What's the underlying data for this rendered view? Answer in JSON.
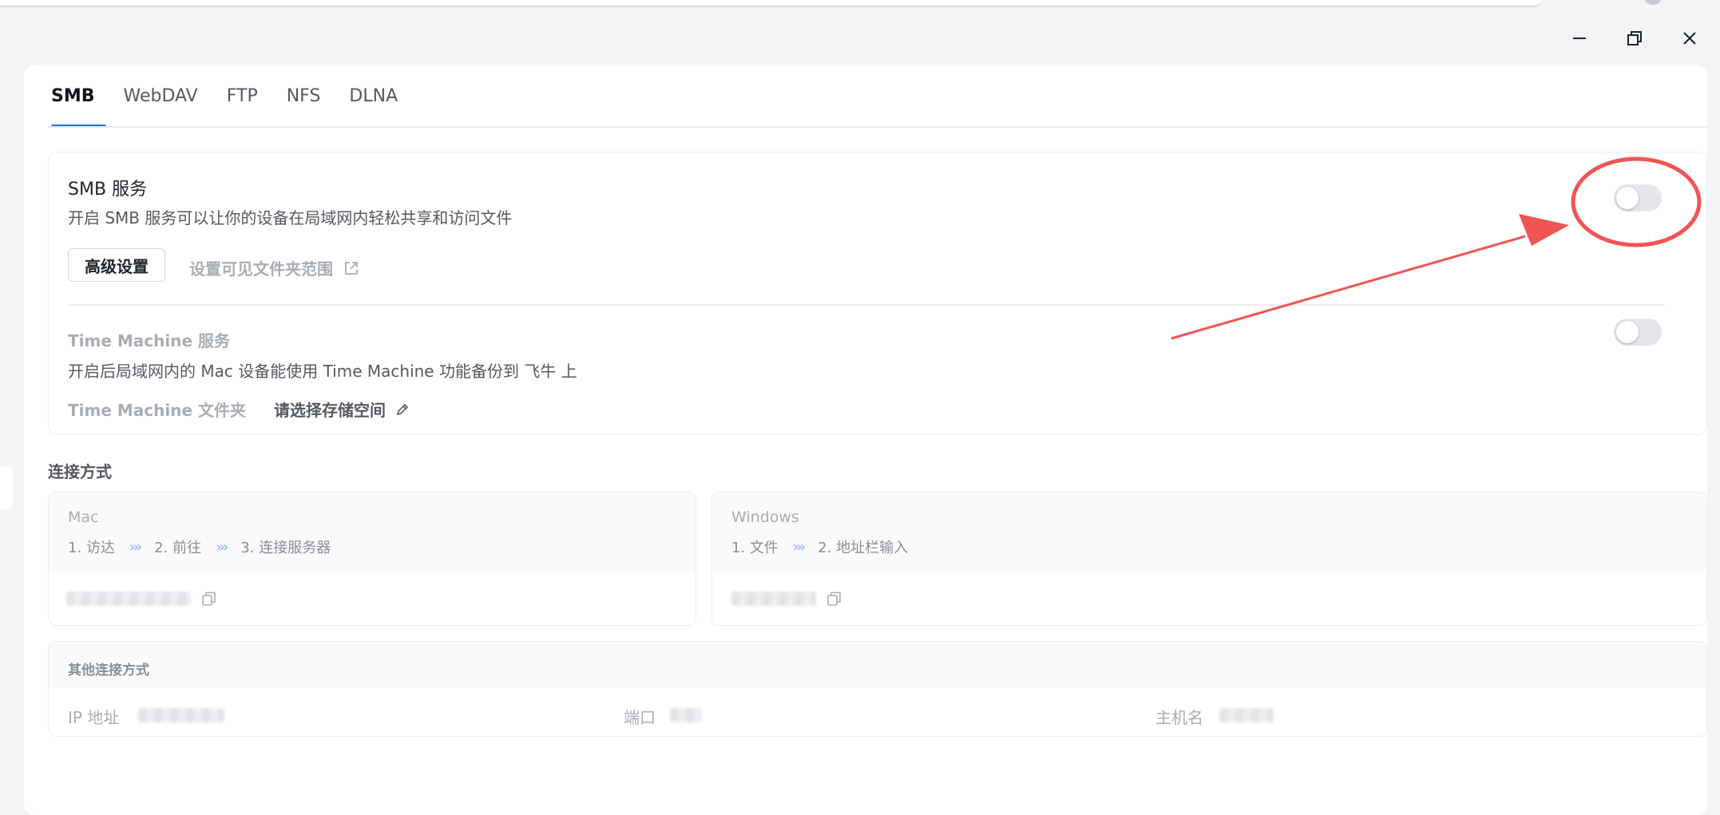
{
  "window": {
    "minimize_icon": "minimize-icon",
    "maximize_icon": "restore-icon",
    "close_icon": "close-icon"
  },
  "tabs": [
    {
      "label": "SMB",
      "active": true
    },
    {
      "label": "WebDAV",
      "active": false
    },
    {
      "label": "FTP",
      "active": false
    },
    {
      "label": "NFS",
      "active": false
    },
    {
      "label": "DLNA",
      "active": false
    }
  ],
  "smb": {
    "title": "SMB 服务",
    "description": "开启 SMB 服务可以让你的设备在局域网内轻松共享和访问文件",
    "advanced_button": "高级设置",
    "range_link": "设置可见文件夹范围",
    "enabled": false
  },
  "time_machine": {
    "title": "Time Machine 服务",
    "description": "开启后局域网内的 Mac 设备能使用 Time Machine 功能备份到 飞牛 上",
    "folder_label": "Time Machine 文件夹",
    "folder_value": "请选择存储空间",
    "enabled": false
  },
  "connection": {
    "heading": "连接方式",
    "mac": {
      "os": "Mac",
      "steps": [
        "1. 访达",
        "2. 前往",
        "3. 连接服务器"
      ]
    },
    "windows": {
      "os": "Windows",
      "steps": [
        "1. 文件",
        "2. 地址栏输入"
      ]
    },
    "chevron": "›››"
  },
  "other": {
    "heading": "其他连接方式",
    "ip_label": "IP 地址",
    "port_label": "端口",
    "host_label": "主机名"
  },
  "colors": {
    "accent": "#1f6feb",
    "annotation": "#f05454"
  }
}
